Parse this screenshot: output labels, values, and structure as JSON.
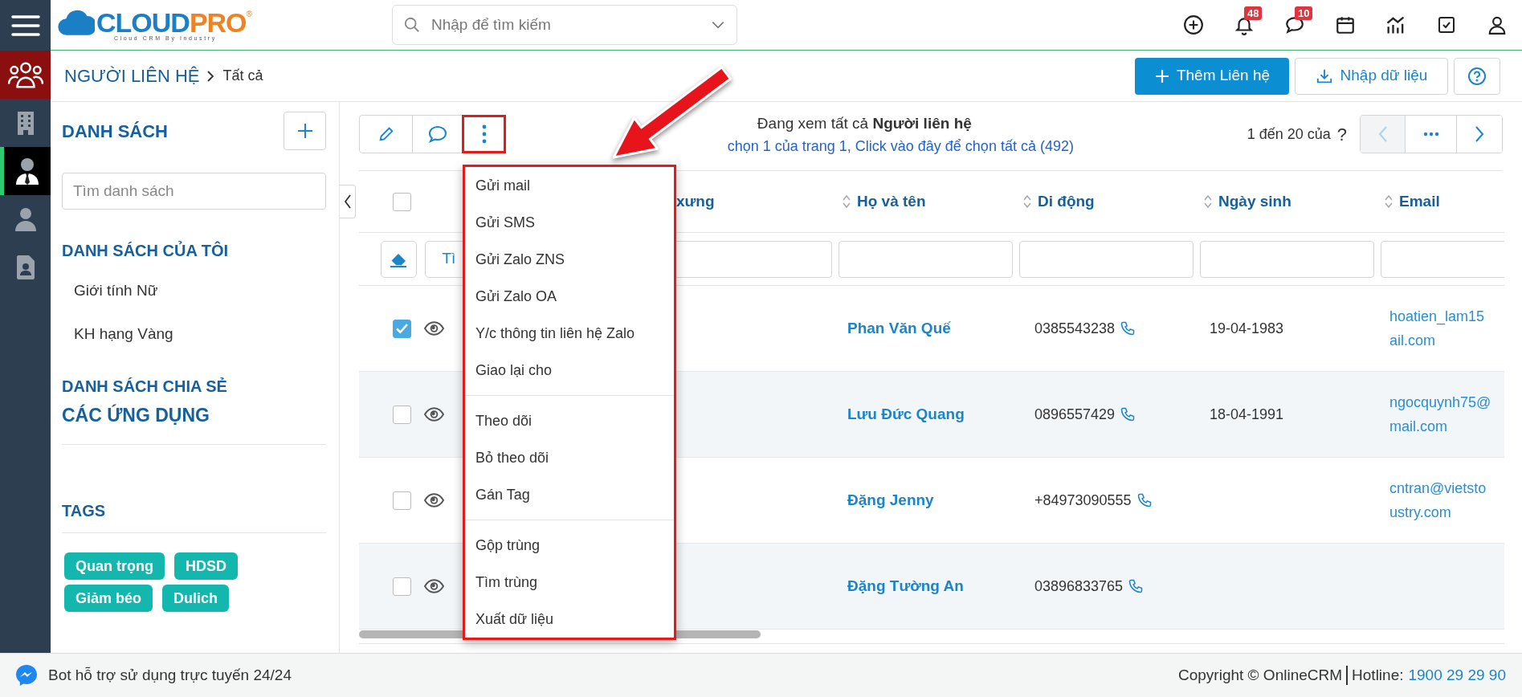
{
  "sidebar": {
    "items": [
      {
        "kind": "section",
        "selected": false
      },
      {
        "kind": "page",
        "selected": false
      },
      {
        "kind": "page",
        "selected": true
      },
      {
        "kind": "page",
        "selected": false
      },
      {
        "kind": "page",
        "selected": false
      }
    ]
  },
  "brand": {
    "name_1": "CLOUD",
    "name_2": "PRO",
    "registered": "®",
    "tagline": "Cloud CRM By Industry"
  },
  "search": {
    "placeholder": "Nhập để tìm kiếm"
  },
  "top_actions": [
    {
      "kind": "add"
    },
    {
      "kind": "bell",
      "badge": "48"
    },
    {
      "kind": "chat",
      "badge": "10"
    },
    {
      "kind": "calendar"
    },
    {
      "kind": "chart"
    },
    {
      "kind": "task"
    },
    {
      "kind": "user"
    }
  ],
  "breadcrumb": {
    "module": "NGƯỜI LIÊN HỆ",
    "current": "Tất cả"
  },
  "header_buttons": [
    {
      "kind": "primary",
      "label": "Thêm Liên hệ"
    },
    {
      "kind": "outline",
      "label": "Nhập dữ liệu"
    },
    {
      "kind": "help"
    }
  ],
  "left_panel": {
    "title": "DANH SÁCH",
    "search_placeholder": "Tìm danh sách",
    "my_lists_title": "DANH SÁCH CỦA TÔI",
    "my_lists": [
      "Giới tính Nữ",
      "KH hạng Vàng"
    ],
    "shared_title": "DANH SÁCH CHIA SẺ",
    "apps_title": "CÁC ỨNG DỤNG",
    "tags_title": "TAGS",
    "tags": [
      "Quan trọng",
      "HDSD",
      "Giảm béo",
      "Dulich"
    ]
  },
  "toolbar": [
    {
      "kind": "edit",
      "highlighted": false
    },
    {
      "kind": "comment",
      "highlighted": false
    },
    {
      "kind": "more",
      "highlighted": true
    }
  ],
  "summary": {
    "text": "Đang xem tất cả **Người liên hệ**",
    "selection_link": "chọn 1 của trang 1, Click vào đây để chọn tất cả (492)"
  },
  "pagination": {
    "range": "1 đến 20 của",
    "total": "?",
    "pager": [
      {
        "kind": "prev",
        "disabled": true
      },
      {
        "kind": "more",
        "disabled": false
      },
      {
        "kind": "next",
        "disabled": false
      }
    ]
  },
  "table": {
    "select_all": {
      "checked": false
    },
    "columns": [
      "xưng",
      "Họ và tên",
      "Di động",
      "Ngày sinh",
      "Email"
    ],
    "filter_button": "Tì",
    "rows": [
      {
        "checked": true,
        "name": "Phan Văn Quế",
        "mobile": "0385543238",
        "birthday": "19-04-1983",
        "email": [
          "hoatien_lam15",
          "ail.com"
        ]
      },
      {
        "checked": false,
        "name": "Lưu Đức Quang",
        "mobile": "0896557429",
        "birthday": "18-04-1991",
        "email": [
          "ngocquynh75@",
          "mail.com"
        ]
      },
      {
        "checked": false,
        "name": "Đặng Jenny",
        "mobile": "+84973090555",
        "email": [
          "cntran@vietsto",
          "ustry.com"
        ]
      },
      {
        "checked": false,
        "name": "Đặng Tường An",
        "mobile": "03896833765"
      }
    ]
  },
  "actions_menu": {
    "open": true,
    "highlighted": true,
    "groups": [
      [
        "Gửi mail",
        "Gửi SMS",
        "Gửi Zalo ZNS",
        "Gửi Zalo OA",
        "Y/c thông tin liên hệ Zalo",
        "Giao lại cho"
      ],
      [
        "Theo dõi",
        "Bỏ theo dõi",
        "Gán Tag"
      ],
      [
        "Gộp trùng",
        "Tìm trùng",
        "Xuất dữ liệu"
      ]
    ]
  },
  "annotation": {
    "kind": "arrow"
  },
  "footer": {
    "bot_text": "Bot hỗ trợ sử dụng trực tuyến 24/24",
    "copyright": "Copyright © OnlineCRM",
    "hotline_label": "Hotline:",
    "hotline": "1900 29 29 90"
  }
}
